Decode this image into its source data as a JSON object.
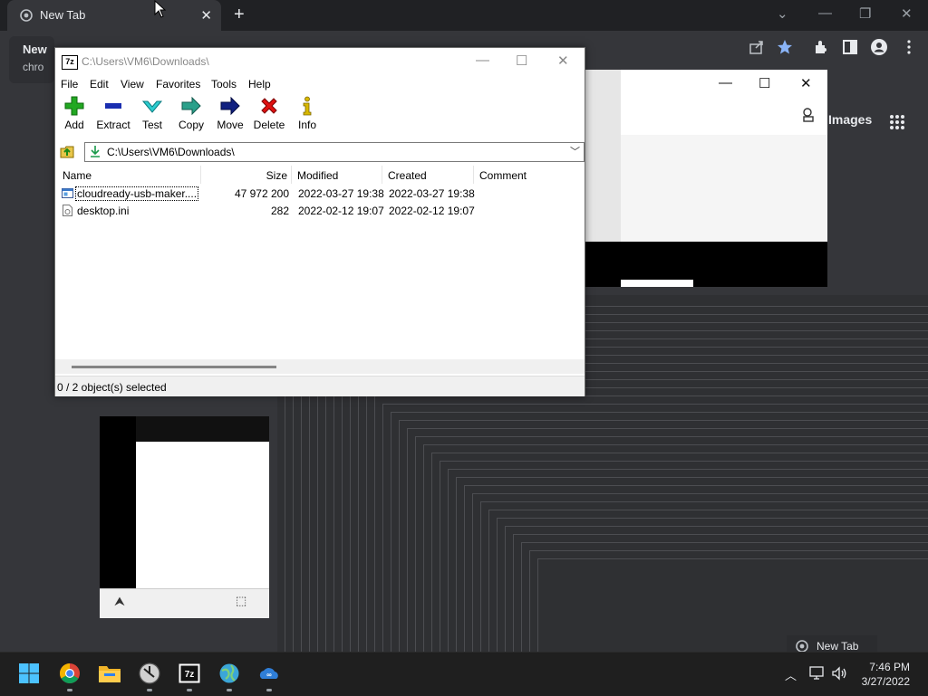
{
  "chrome": {
    "tab_title": "New Tab",
    "tab_close": "✕",
    "new_tab": "+",
    "bookmark_title": "New",
    "bookmark_sub": "chro",
    "window_controls": [
      "⌄",
      "—",
      "❐",
      "✕"
    ]
  },
  "bg_window": {
    "controls": [
      "—",
      "☐",
      "✕"
    ],
    "images_label": "Images",
    "apps_grid": "⋮⋮⋮"
  },
  "zip": {
    "title": "C:\\Users\\VM6\\Downloads\\",
    "window_controls": [
      "—",
      "☐",
      "✕"
    ],
    "menu": [
      "File",
      "Edit",
      "View",
      "Favorites",
      "Tools",
      "Help"
    ],
    "toolbar": [
      "Add",
      "Extract",
      "Test",
      "Copy",
      "Move",
      "Delete",
      "Info"
    ],
    "address": "C:\\Users\\VM6\\Downloads\\",
    "columns": [
      "Name",
      "Size",
      "Modified",
      "Created",
      "Comment"
    ],
    "rows": [
      {
        "name": "cloudready-usb-maker....",
        "size": "47 972 200",
        "modified": "2022-03-27 19:38",
        "created": "2022-03-27 19:38",
        "comment": ""
      },
      {
        "name": "desktop.ini",
        "size": "282",
        "modified": "2022-02-12 19:07",
        "created": "2022-02-12 19:07",
        "comment": ""
      }
    ],
    "status": "0 / 2 object(s) selected"
  },
  "taskbar": {
    "apps": [
      "start-icon",
      "chrome-icon",
      "file-explorer-icon",
      "clock-app-icon",
      "7zip-icon",
      "network-globe-icon",
      "onedrive-app-icon"
    ],
    "preview_label": "New Tab",
    "time": "7:46 PM",
    "date": "3/27/2022"
  },
  "colors": {
    "chrome_dark": "#202124",
    "taskbar": "#1f1f1f",
    "add_green": "#22a822",
    "delete_red": "#e01010",
    "move_blue": "#102080"
  }
}
